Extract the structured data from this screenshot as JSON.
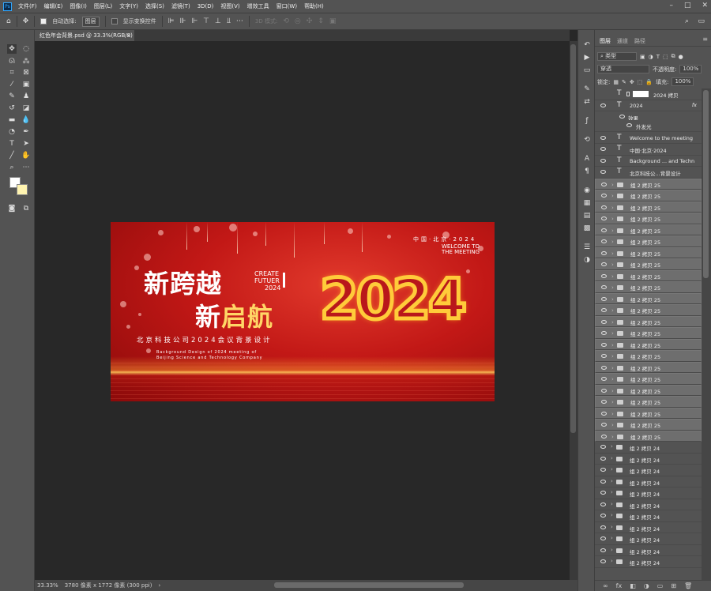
{
  "menubar": {
    "logo": "Ps",
    "items": [
      "文件(F)",
      "编辑(E)",
      "图像(I)",
      "图层(L)",
      "文字(Y)",
      "选择(S)",
      "滤镜(T)",
      "3D(D)",
      "视图(V)",
      "增效工具",
      "窗口(W)",
      "帮助(H)"
    ],
    "window_controls": [
      "–",
      "□",
      "✕"
    ]
  },
  "options": {
    "auto_select_label": "自动选择:",
    "auto_select_value": "图层",
    "show_transform_label": "显示变换控件",
    "mode_3d_label": "3D 模式:"
  },
  "document": {
    "tab_title": "红色年会背景.psd @ 33.3%(RGB/8)",
    "tab_close": "×",
    "zoom": "33.33%",
    "info": "3780 像素 x 1772 像素 (300 ppi)"
  },
  "artwork": {
    "headline1": "新跨越",
    "headline2_white": "新",
    "headline2_yellow": "启航",
    "create_line1": "CREATE",
    "create_line2": "FUTUER",
    "create_line3": "2024",
    "year": "2024",
    "location": "中国·北京·2024",
    "welcome_line1": "WELCOME TO",
    "welcome_line2": "THE MEETING",
    "subtitle": "北京科技公司2024会议背景设计",
    "english_line1": "Background Design of 2024 meeting of",
    "english_line2": "Beijing Science and Technology Company"
  },
  "layers_panel": {
    "tabs": [
      "图层",
      "通道",
      "路径"
    ],
    "menu_icon": "≡",
    "filter_label": "类型",
    "blend_mode": "穿透",
    "opacity_label": "不透明度:",
    "opacity_value": "100%",
    "lock_label": "锁定:",
    "fill_label": "填充:",
    "fill_value": "100%",
    "top_layers": [
      {
        "type": "T",
        "name": "2024 拷贝"
      },
      {
        "type": "T",
        "name": "2024",
        "fx": "fx"
      }
    ],
    "effects_label": "效果",
    "effect_name": "外发光",
    "text_layers": [
      {
        "type": "T",
        "name": "Welcome to the meeting"
      },
      {
        "type": "T",
        "name": "中国·北京·2024"
      },
      {
        "type": "T",
        "name": "Background ... and Techn"
      },
      {
        "type": "T",
        "name": "北京科技公...背景设计"
      }
    ],
    "groups_selected": [
      "组 2 拷贝 25",
      "组 2 拷贝 25",
      "组 2 拷贝 25",
      "组 2 拷贝 25",
      "组 2 拷贝 25",
      "组 2 拷贝 25",
      "组 2 拷贝 25",
      "组 2 拷贝 25",
      "组 2 拷贝 25",
      "组 2 拷贝 25",
      "组 2 拷贝 25",
      "组 2 拷贝 25",
      "组 2 拷贝 25",
      "组 2 拷贝 25",
      "组 2 拷贝 25",
      "组 2 拷贝 25",
      "组 2 拷贝 25",
      "组 2 拷贝 25",
      "组 2 拷贝 25",
      "组 2 拷贝 25",
      "组 2 拷贝 25",
      "组 2 拷贝 25",
      "组 2 拷贝 25"
    ],
    "groups_plain": [
      "组 2 拷贝 24",
      "组 2 拷贝 24",
      "组 2 拷贝 24",
      "组 2 拷贝 24",
      "组 2 拷贝 24",
      "组 2 拷贝 24",
      "组 2 拷贝 24",
      "组 2 拷贝 24",
      "组 2 拷贝 24",
      "组 2 拷贝 24",
      "组 2 拷贝 24"
    ],
    "footer_icons": [
      "∞",
      "fx",
      "◧",
      "◑",
      "▭",
      "⊞",
      "🗑"
    ]
  },
  "colors": {
    "ui_bg": "#535353",
    "canvas_bg": "#282828",
    "artwork_red": "#c21816",
    "year_stroke": "#ffcb3a",
    "headline_yellow": "#ffd666",
    "selected_layer": "#6e6e6e"
  }
}
